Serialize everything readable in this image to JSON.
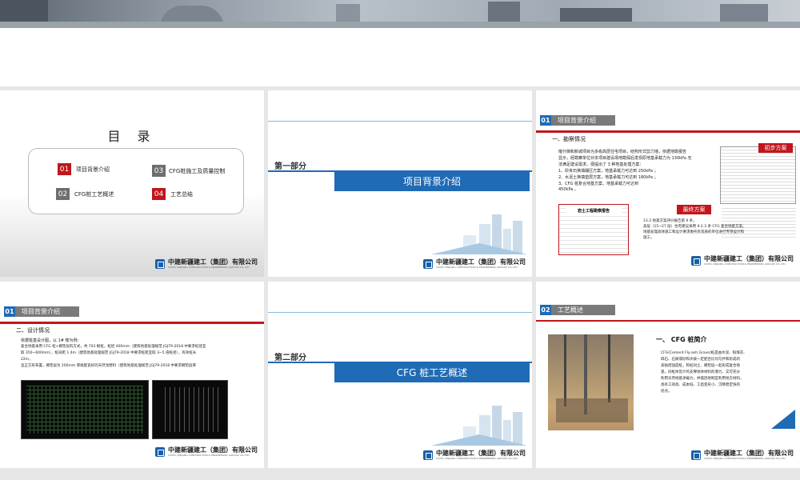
{
  "s1": {
    "title": "目 录",
    "items": [
      {
        "num": "01",
        "label": "项目背景介绍",
        "color": "#c0161c"
      },
      {
        "num": "03",
        "label": "CFG桩施工及质量控制",
        "color": "#6e6e6e"
      },
      {
        "num": "02",
        "label": "CFG桩工艺概述",
        "color": "#6e6e6e"
      },
      {
        "num": "04",
        "label": "工艺总结",
        "color": "#c0161c"
      }
    ]
  },
  "company": {
    "name": "中建新疆建工（集团）有限公司",
    "en": "CSCEC XINJIANG CONSTRUCTION & ENGINEERING (GROUP) CO.,LTD."
  },
  "s2": {
    "part": "第一部分",
    "banner": "项目背景介绍"
  },
  "s3": {
    "num": "01",
    "section": "项目背景介绍",
    "sub": "一、勘察情况",
    "lines": [
      "喀什御和新城项目为多栋高层住宅项目，结构形式剪力墙，依据地勘报告",
      "显示，经勘察单位对本项目建设场地勘探后发现原地基承载力为 130kPa 无",
      "法满足建设需求，便提出了 3 种地基处理方案：",
      "1、砂夹石换填碾压方案，地基承载力可达到 250kPa ；",
      "2、水泥土换填垫层方案，地基承载力可达到 180kPa ；",
      "3、CFG 桩复合地基方案，地基承载力可达到",
      "450kPa 。"
    ],
    "tag1": "初步方案",
    "tag2": "最终方案",
    "report": "岩土工程勘察报告",
    "note": [
      "13.3 地基方案评价报告第 9 条，",
      "高层（15~27 层）住宅建议采用 9.2.3 条 CFG 复合地基方案。",
      "地基处理具体施工和设计要求委托有资质的单位进行专项设计和",
      "施工。"
    ]
  },
  "s4": {
    "num": "01",
    "section": "项目背景介绍",
    "sub": "二、设计情况",
    "lines": [
      "依据桩基设计图，以 1# 楼为例：",
      "复合地基采用 CFG 桩+褥垫层的方式，共 703 根桩，桩径 400mm（建筑地基处理规范 JGJ79-2018 中要求桩径宜",
      "取 350~600mm），桩间距 1.4m（建筑地基处理规范 JGJ79-2018 中要求桩距宜取 3~5 倍桩径），有效桩长",
      "22m，",
      "呈正方形布置，褥垫层为 200mm 厚级配良好的天然戈壁料（建筑地基处理规范 JGJ79-2018 中要求褥垫层厚"
    ]
  },
  "s5": {
    "part": "第二部分",
    "banner": "CFG 桩工艺概述"
  },
  "s6": {
    "num": "02",
    "section": "工艺概述",
    "sub": "一、 CFG 桩简介",
    "lines": [
      "CFG(Cement Fly-ash Grave)桩是由水泥、粉煤灰、",
      "碎石、石屑或砂和水按一定配合比均匀拌和形成的",
      "高粘结强度桩，和桩间土、褥垫层一起形成复合地",
      "基，同桩体及计的支撑地体材料的潜力，又可充分",
      "利用天然地基承载力，并能因地制宜利用地方材料，",
      "具有工效高、成本低、工后变形小、沉降稳定快的",
      "优点。"
    ]
  }
}
